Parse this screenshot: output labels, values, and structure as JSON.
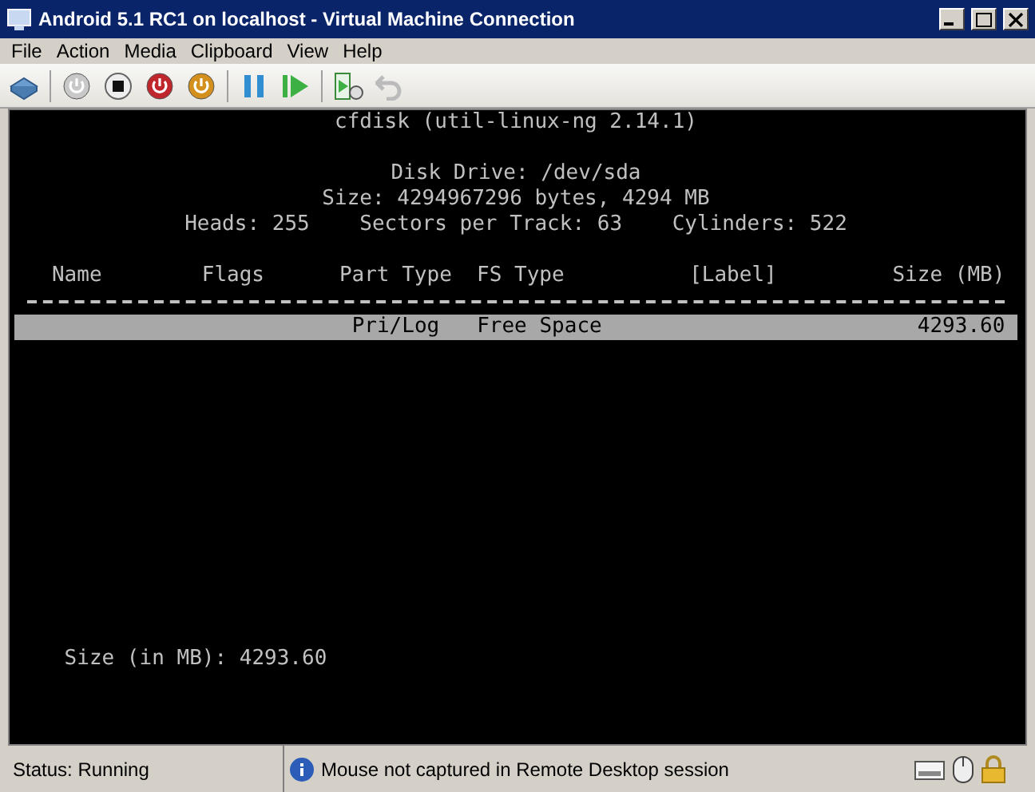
{
  "window": {
    "title": "Android 5.1 RC1 on localhost - Virtual Machine Connection"
  },
  "menu": [
    "File",
    "Action",
    "Media",
    "Clipboard",
    "View",
    "Help"
  ],
  "toolbar": [
    {
      "kind": "ctrl-alt-del",
      "disabled": false
    },
    {
      "kind": "start",
      "disabled": true
    },
    {
      "kind": "stop",
      "disabled": false
    },
    {
      "kind": "turn-off",
      "disabled": false
    },
    {
      "kind": "shut-down",
      "disabled": false
    },
    {
      "kind": "pause",
      "disabled": false
    },
    {
      "kind": "resume",
      "disabled": false
    },
    {
      "kind": "snapshot",
      "disabled": false
    },
    {
      "kind": "revert",
      "disabled": true
    }
  ],
  "terminal": {
    "title_line": "cfdisk (util-linux-ng 2.14.1)",
    "disk_lines": [
      "Disk Drive: /dev/sda",
      "Size: 4294967296 bytes, 4294 MB"
    ],
    "geometry": [
      "Heads: 255",
      "Sectors per Track: 63",
      "Cylinders: 522"
    ],
    "columns": [
      "Name",
      "Flags",
      "Part Type",
      "FS Type",
      "[Label]",
      "Size (MB)"
    ],
    "rows": [
      {
        "part_type": "Pri/Log",
        "fs_type": "Free Space",
        "size": "4293.60",
        "selected": true
      }
    ],
    "prompt": "Size (in MB): 4293.60"
  },
  "status_bar": {
    "status": "Status: Running",
    "message": "Mouse not captured in Remote Desktop session"
  }
}
